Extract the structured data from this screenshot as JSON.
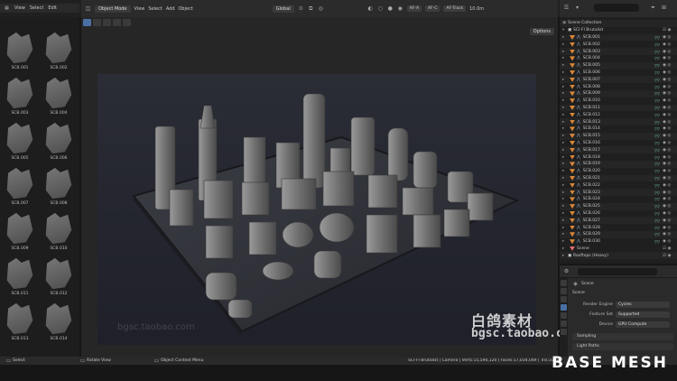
{
  "left_header": {
    "menu": [
      "View",
      "Select",
      "Edit"
    ]
  },
  "asset_browser": {
    "items": [
      "SCB.001",
      "SCB.002",
      "SCB.003",
      "SCB.004",
      "SCB.005",
      "SCB.006",
      "SCB.007",
      "SCB.008",
      "SCB.009",
      "SCB.010",
      "SCB.011",
      "SCB.012",
      "SCB.013",
      "SCB.014"
    ]
  },
  "viewport_header": {
    "mode": "Object Mode",
    "menu": [
      "View",
      "Select",
      "Add",
      "Object"
    ],
    "transform": "Global",
    "af_chips": [
      "AF-A",
      "AF-C",
      "AF-Track"
    ],
    "distance": "10.0m",
    "options": "Options"
  },
  "outliner": {
    "scene_collection": "Scene Collection",
    "collection": "SCI-FI Brutalist",
    "objects": [
      "SCB.001",
      "SCB.002",
      "SCB.003",
      "SCB.004",
      "SCB.005",
      "SCB.006",
      "SCB.007",
      "SCB.008",
      "SCB.009",
      "SCB.010",
      "SCB.011",
      "SCB.012",
      "SCB.013",
      "SCB.014",
      "SCB.015",
      "SCB.016",
      "SCB.017",
      "SCB.018",
      "SCB.019",
      "SCB.020",
      "SCB.021",
      "SCB.022",
      "SCB.023",
      "SCB.024",
      "SCB.025",
      "SCB.026",
      "SCB.027",
      "SCB.028",
      "SCB.029",
      "SCB.030"
    ],
    "extra": [
      "Scene",
      "Rooftops (Heavy)"
    ]
  },
  "properties": {
    "context": "Scene",
    "title": "Scene",
    "render_engine_label": "Render Engine",
    "render_engine": "Cycles",
    "feature_set_label": "Feature Set",
    "feature_set": "Supported",
    "device_label": "Device",
    "device": "GPU Compute",
    "sections": [
      "Sampling",
      "Light Paths"
    ]
  },
  "status_bar": {
    "select": "Select",
    "rotate": "Rotate View",
    "context_menu": "Object Context Menu",
    "stats": "SCI-FI Brutalist | Camera | Verts:15,594,120 | Faces:17,034,049 | Tris:33,691,..."
  },
  "watermark": {
    "cn": "白鸽素材",
    "url": "bgsc.taobao.com",
    "faint": "bgsc.taobao.com"
  },
  "brand": "BASE MESH",
  "colors": {
    "accent": "#4a6fa5",
    "object_orange": "#d9873a",
    "mesh_blue": "#8db4e0"
  }
}
